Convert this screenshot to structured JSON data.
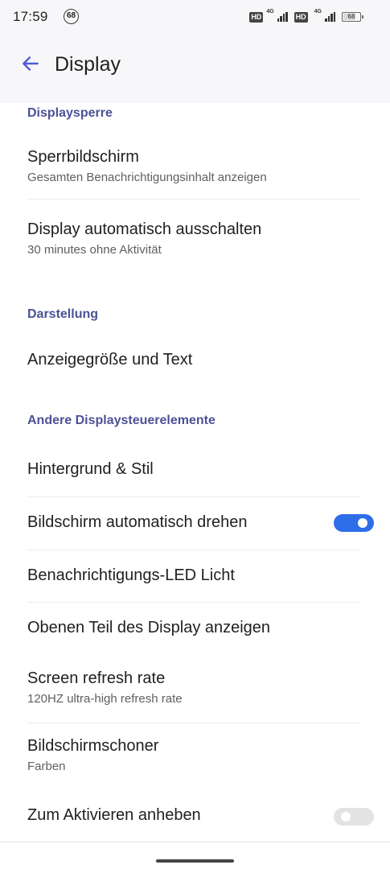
{
  "status_bar": {
    "time": "17:59",
    "notification_count": "68",
    "hd_label": "HD",
    "network_label": "4G",
    "battery_level": "68"
  },
  "app_bar": {
    "title": "Display",
    "back_icon": "arrow-left-icon",
    "accent_color": "#4f5bd5"
  },
  "sections": {
    "lock": "Displaysperre",
    "appearance": "Darstellung",
    "other": "Andere Displaysteuerelemente"
  },
  "items": {
    "lock_screen": {
      "title": "Sperrbildschirm",
      "subtitle": "Gesamten Benachrichtigungsinhalt anzeigen"
    },
    "screen_timeout": {
      "title": "Display automatisch ausschalten",
      "subtitle": "30 minutes ohne Aktivität"
    },
    "display_size": {
      "title": "Anzeigegröße und Text"
    },
    "wallpaper": {
      "title": "Hintergrund & Stil"
    },
    "auto_rotate": {
      "title": "Bildschirm automatisch drehen",
      "enabled": true
    },
    "notification_led": {
      "title": "Benachrichtigungs-LED Licht"
    },
    "show_top_display": {
      "title": "Obenen Teil des Display anzeigen"
    },
    "refresh_rate": {
      "title": "Screen refresh rate",
      "subtitle": "120HZ ultra-high refresh rate"
    },
    "screensaver": {
      "title": "Bildschirmschoner",
      "subtitle": "Farben"
    },
    "lift_to_wake": {
      "title": "Zum Aktivieren anheben",
      "enabled": false
    }
  },
  "colors": {
    "section_header": "#4b5296",
    "toggle_on": "#2f6ee9",
    "toggle_off": "#e3e3e3"
  }
}
